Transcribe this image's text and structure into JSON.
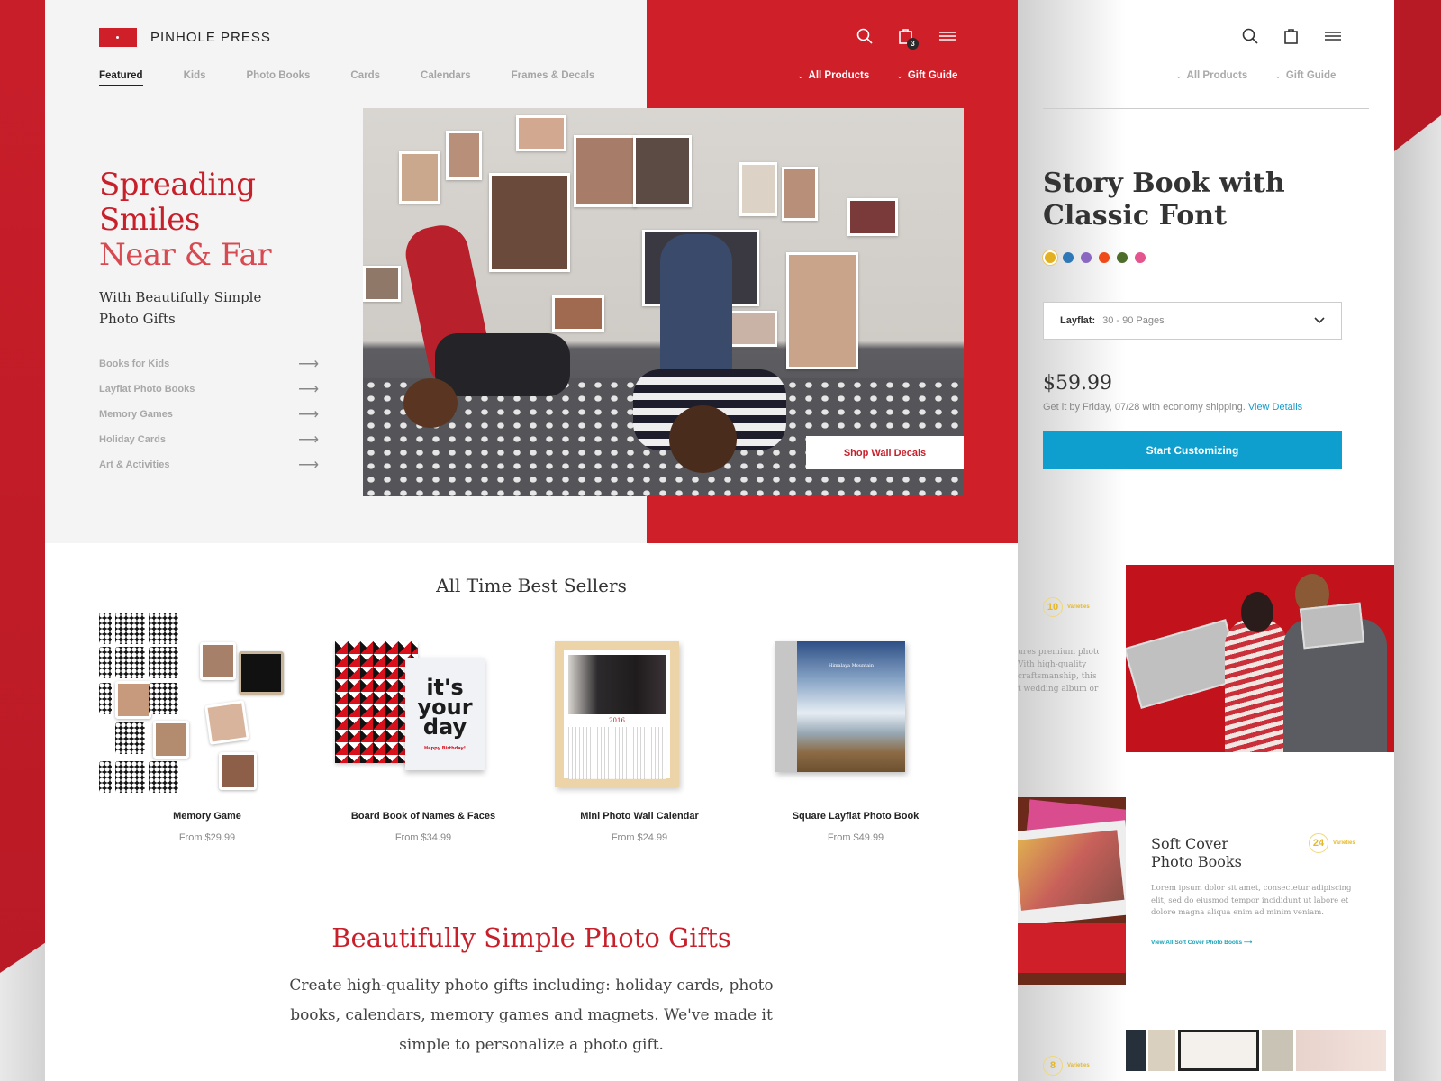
{
  "brand": {
    "name": "PINHOLE PRESS",
    "accent": "#cf1f29",
    "cta_color": "#0e9fcf"
  },
  "nav": {
    "tabs": [
      {
        "label": "Featured",
        "active": true
      },
      {
        "label": "Kids"
      },
      {
        "label": "Photo Books"
      },
      {
        "label": "Cards"
      },
      {
        "label": "Calendars"
      },
      {
        "label": "Frames & Decals"
      }
    ],
    "right_links": [
      "All Products",
      "Gift Guide"
    ],
    "cart_count": "3",
    "icons": [
      "search-icon",
      "shopping-bag-icon",
      "menu-icon"
    ]
  },
  "hero": {
    "title_lines": [
      "Spreading",
      "Smiles",
      "Near & Far"
    ],
    "subtitle_lines": [
      "With Beautifully Simple",
      "Photo Gifts"
    ],
    "categories": [
      "Books for Kids",
      "Layflat Photo Books",
      "Memory Games",
      "Holiday Cards",
      "Art & Activities"
    ],
    "cta": "Shop Wall Decals"
  },
  "best_sellers": {
    "title": "All Time Best Sellers",
    "products": [
      {
        "name": "Memory Game",
        "price": "From $29.99"
      },
      {
        "name": "Board Book of Names & Faces",
        "price": "From $34.99"
      },
      {
        "name": "Mini Photo Wall Calendar",
        "price": "From $24.99"
      },
      {
        "name": "Square Layflat Photo Book",
        "price": "From $49.99"
      }
    ],
    "card_text": [
      "it's",
      "your",
      "day"
    ],
    "card_footer": "Happy Birthday!",
    "calendar_year": "2016",
    "book_cover_text": "Himalaya Mountain"
  },
  "gifts": {
    "title": "Beautifully Simple Photo Gifts",
    "body": "Create high-quality photo gifts including: holiday cards, photo books, calendars, memory games and magnets. We've made it simple to personalize a photo gift."
  },
  "panel": {
    "links": [
      "All Products",
      "Gift Guide"
    ],
    "title_lines": [
      "Story Book with",
      "Classic Font"
    ],
    "swatches": [
      "#e3b021",
      "#2f78b8",
      "#8a68c2",
      "#ef4a17",
      "#4f6d2a",
      "#e4558f"
    ],
    "select": {
      "key": "Layflat:",
      "value": "30 - 90 Pages"
    },
    "price": "$59.99",
    "shipping": "Get it by Friday, 07/28 with economy shipping.",
    "shipping_link": "View Details",
    "cta": "Start Customizing",
    "varieties": [
      {
        "num": "10",
        "label": "Varieties"
      },
      {
        "num": "24",
        "label": "Varieties"
      },
      {
        "num": "8",
        "label": "Varieties"
      }
    ],
    "snippet_lines": [
      "ures premium photo",
      "Vith high-quality",
      "craftsmanship, this",
      "t wedding album or"
    ],
    "soft_cover": {
      "title_lines": [
        "Soft Cover",
        "Photo Books"
      ],
      "body": "Lorem ipsum dolor sit amet, consectetur adipiscing elit, sed do eiusmod tempor incididunt ut labore et dolore magna aliqua enim ad minim veniam.",
      "link": "View All Soft Cover Photo Books"
    }
  }
}
